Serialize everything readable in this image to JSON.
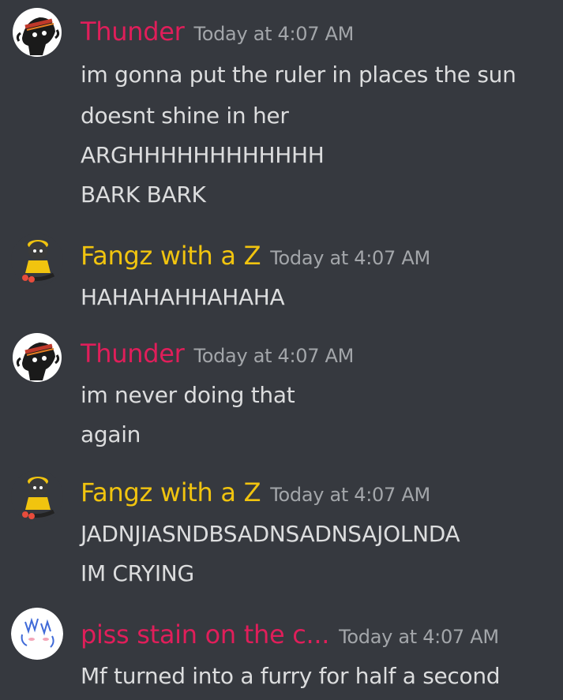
{
  "colors": {
    "background": "#36393f",
    "thunder_name": "#e01e5a",
    "fangz_name": "#f1c40f",
    "piss_name": "#e01e5a",
    "timestamp": "#a3a6aa",
    "text": "#dcddde"
  },
  "messages": [
    {
      "author": "Thunder",
      "timestamp": "Today at 4:07 AM",
      "avatar_icon": "thunder-avatar",
      "lines": [
        "im gonna put the ruler in places the sun",
        "doesnt shine in her",
        "ARGHHHHHHHHHHHH",
        "BARK BARK"
      ]
    },
    {
      "author": "Fangz with a Z",
      "timestamp": "Today at 4:07 AM",
      "avatar_icon": "fangz-avatar",
      "lines": [
        "HAHAHAHHAHAHA"
      ]
    },
    {
      "author": "Thunder",
      "timestamp": "Today at 4:07 AM",
      "avatar_icon": "thunder-avatar",
      "lines": [
        "im never doing that",
        "again"
      ]
    },
    {
      "author": "Fangz with a Z",
      "timestamp": "Today at 4:07 AM",
      "avatar_icon": "fangz-avatar",
      "lines": [
        "JADNJIASNDBSADNSADNSAJOLNDA",
        "IM CRYING"
      ]
    },
    {
      "author": "piss stain on the c...",
      "timestamp": "Today at 4:07 AM",
      "avatar_icon": "piss-avatar",
      "lines": [
        "Mf turned into a furry for half a second"
      ]
    }
  ]
}
